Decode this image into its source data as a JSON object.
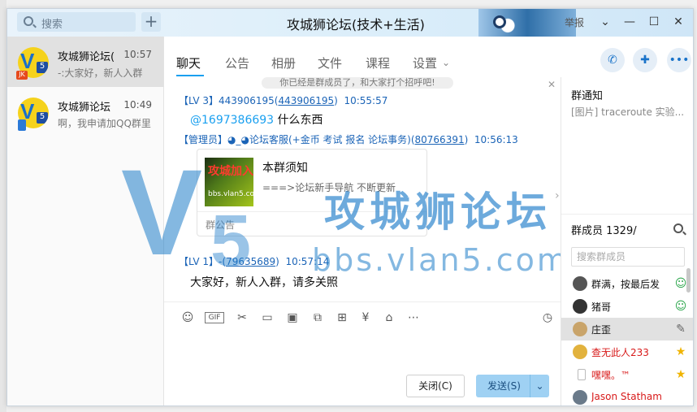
{
  "window": {
    "title": "攻城狮论坛(技术+生活)",
    "report_label": "举报"
  },
  "search": {
    "placeholder": "搜索"
  },
  "conversations": [
    {
      "name": "攻城狮论坛(",
      "time": "10:57",
      "snippet": "-:大家好，新人入群"
    },
    {
      "name": "攻城狮论坛",
      "time": "10:49",
      "snippet": "啊，我申请加QQ群里"
    }
  ],
  "tabs": [
    "聊天",
    "公告",
    "相册",
    "文件",
    "课程",
    "设置"
  ],
  "chat": {
    "system_note": "你已经是群成员了，和大家打个招呼吧!",
    "messages": [
      {
        "level": "【LV 3】",
        "sender": "443906195",
        "sender_id": "443906195",
        "time": "10:55:57",
        "mention": "@1697386693",
        "text": " 什么东西"
      },
      {
        "level": "【管理员】",
        "sender": "◕_◕论坛客服(+金币 考试 报名 论坛事务)",
        "sender_id": "80766391",
        "time": "10:56:13"
      },
      {
        "level": "【LV 1】",
        "sender": "-",
        "sender_id": "79635689",
        "time": "10:57:14",
        "text": "大家好，新人入群，请多关照"
      }
    ],
    "card": {
      "thumb_title": "攻城加入",
      "thumb_url": "bbs.vlan5.com",
      "title": "本群须知",
      "desc": "===>论坛新手导航 不断更新",
      "footer": "群公告"
    }
  },
  "watermark": {
    "brand": "攻城狮论坛",
    "url": "bbs.vlan5.com"
  },
  "buttons": {
    "close": "关闭(C)",
    "send": "发送(S)"
  },
  "right_panel": {
    "notice_title": "群通知",
    "notice_text": "[图片] traceroute 实验...",
    "members_title": "群成员 1329/",
    "members_search_placeholder": "搜索群成员",
    "members": [
      {
        "name": "群满，按最后发",
        "red": false,
        "role": "member"
      },
      {
        "name": "猪哥",
        "red": false,
        "role": "member"
      },
      {
        "name": "庄歪",
        "red": false,
        "role": "edit"
      },
      {
        "name": "查无此人233",
        "red": true,
        "role": "star"
      },
      {
        "name": "嘿嘿。™",
        "red": true,
        "role": "star"
      },
      {
        "name": "Jason Statham",
        "red": true,
        "role": ""
      }
    ]
  },
  "colors": {
    "accent": "#1aa0f0",
    "link": "#1b64b7",
    "send_button": "#9fd1f3",
    "watermark": "#1f7dc9"
  }
}
